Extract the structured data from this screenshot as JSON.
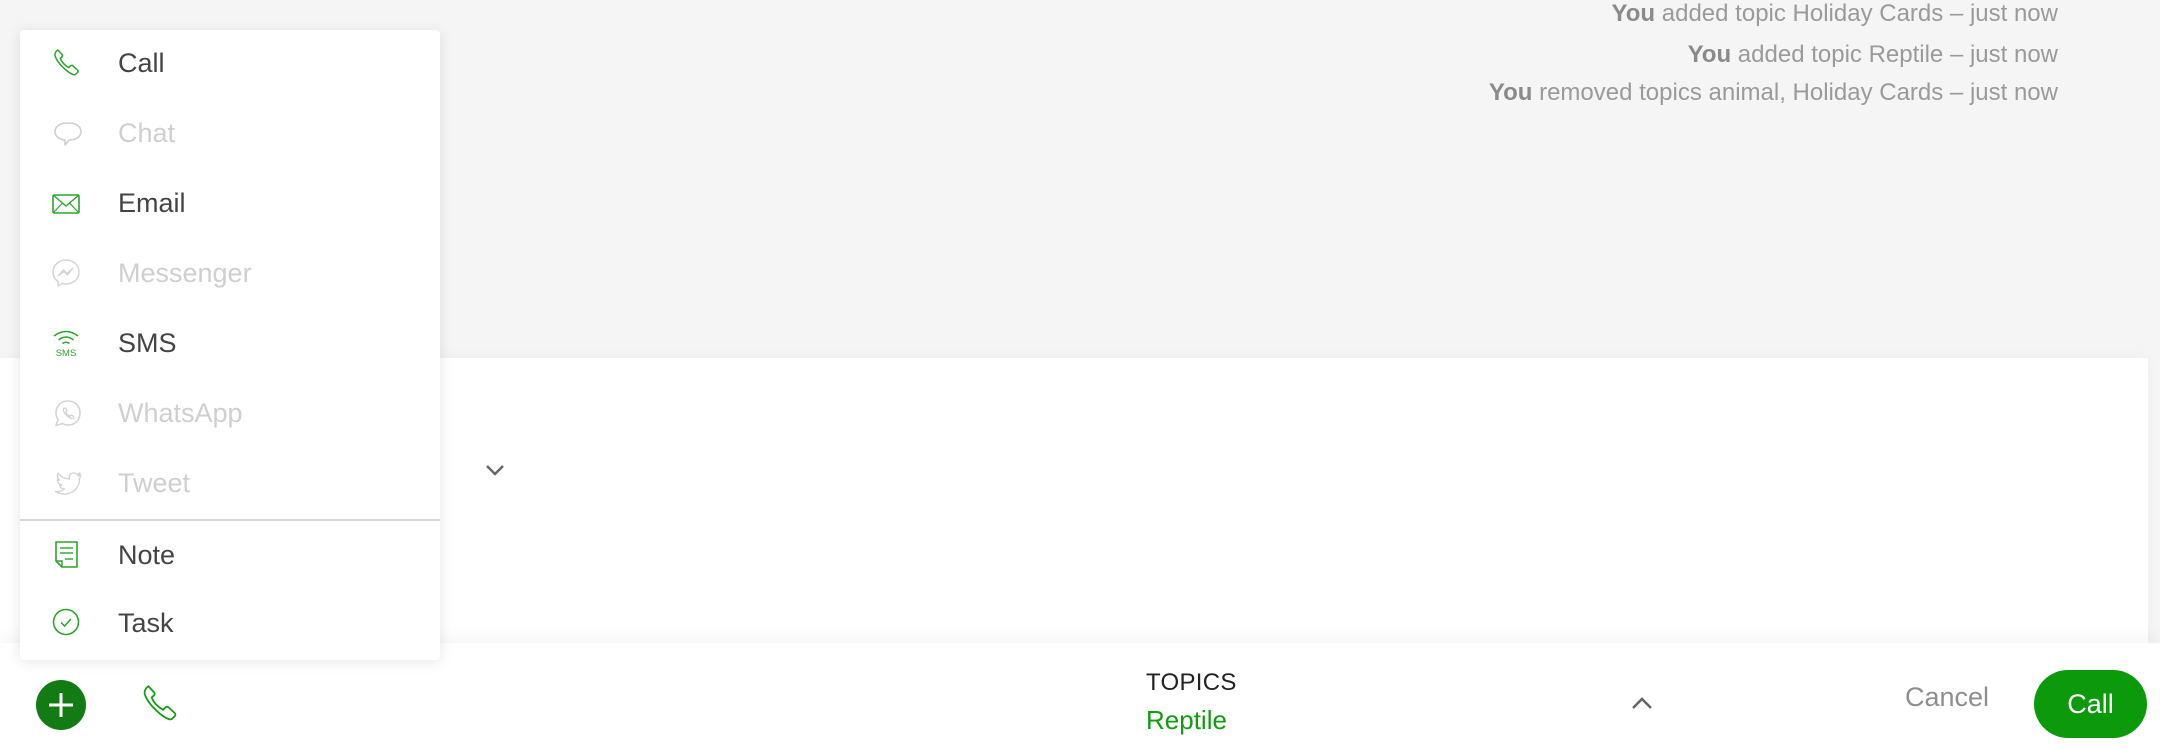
{
  "activity": [
    {
      "actor": "You",
      "text": "added topic Holiday Cards – just now"
    },
    {
      "actor": "You",
      "text": "added topic Reptile – just now"
    },
    {
      "actor": "You",
      "text": "removed topics animal, Holiday Cards – just now"
    }
  ],
  "menu": {
    "channels": [
      {
        "label": "Call",
        "icon": "phone-icon",
        "enabled": true
      },
      {
        "label": "Chat",
        "icon": "chat-bubble-icon",
        "enabled": false
      },
      {
        "label": "Email",
        "icon": "envelope-icon",
        "enabled": true
      },
      {
        "label": "Messenger",
        "icon": "messenger-icon",
        "enabled": false
      },
      {
        "label": "SMS",
        "icon": "sms-icon",
        "enabled": true
      },
      {
        "label": "WhatsApp",
        "icon": "whatsapp-icon",
        "enabled": false
      },
      {
        "label": "Tweet",
        "icon": "twitter-bird-icon",
        "enabled": false
      }
    ],
    "other": [
      {
        "label": "Note",
        "icon": "note-icon",
        "enabled": true
      },
      {
        "label": "Task",
        "icon": "check-circle-icon",
        "enabled": true
      }
    ]
  },
  "bottom_bar": {
    "topics_label": "TOPICS",
    "topics_value": "Reptile",
    "cancel_label": "Cancel",
    "submit_label": "Call"
  },
  "colors": {
    "accent": "#0c9a0c",
    "add_button": "#137b13",
    "icon_green": "#2aa52a",
    "disabled": "#cfcfcf"
  }
}
